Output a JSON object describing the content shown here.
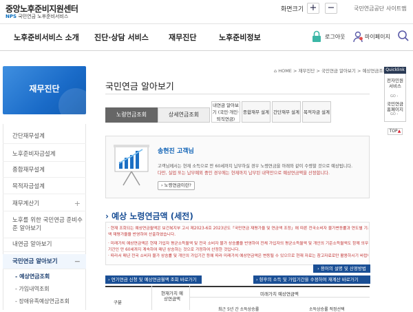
{
  "header": {
    "logo_title": "중앙노후준비지원센터",
    "logo_nps": "NPS",
    "logo_sub": "국민연금 노후준비서비스",
    "font_size_label": "화면크기",
    "font_plus": "+",
    "font_minus": "−",
    "nps_link": "국민연금공단",
    "sitemap_link": "사이트맵"
  },
  "nav": {
    "items": [
      "노후준비서비스 소개",
      "진단·상담 서비스",
      "재무진단",
      "노후준비정보"
    ],
    "logout": "로그아웃",
    "mypage": "마이페이지"
  },
  "sidebar": {
    "banner_title": "재무진단",
    "items": [
      "간단재무설계",
      "노후준비자금설계",
      "종합재무설계",
      "목적자금설계",
      "재무계산기",
      "노후를 위한 국민연금 준비수준 알아보기",
      "내연금 알아보기",
      "국민연금 알아보기"
    ],
    "sub_items": [
      "- 예상연금조회",
      "- 가입내역조회",
      "- 장애유족예상연금조회"
    ]
  },
  "main": {
    "breadcrumb": "⌂ HOME > 재무진단 > 국민연금 알아보기 > 예상연금조회",
    "title": "국민연금 알아보기",
    "tabs": [
      "노령연금조회",
      "상세연금조회",
      "내연금 알아보기 (국민·개인·퇴직연금)",
      "종합재무 설계",
      "간단재무 설계",
      "목적자금 설계"
    ],
    "user_name": "송현진 고객님",
    "info_line_1": "고객님께서는 현재 소득으로 만 60세까지 납부하실 경우 노령연금을 아래와 같이 수령할 것으로 예상됩니다.",
    "info_line_2": "다만, 실업 또는 납부예외 중인 경우에는 현재까지 납부된 내역만으로 예상연금액을 산정합니다.",
    "info_button": "› 노령연금이란?",
    "section_heading": "예상 노령연금액 (세전)",
    "notes": [
      "· 현재 조회되는 예상연금월액은 보건복지부 고시 제2023-6호 2023년도「국민연금 재평가율 및 연금액 조정」에 따른 전국소비자 물가변동률과 연도별 기준소득월",
      "액 재평가율을 반영하여 산출하였습니다.",
      "· 미래가치 예상연금액은 현재 가입자 평균소득월액 및 전국 소비자 물가 상승률을 반영하여 전체 가입자의 평균소득월액 및 개인의 기준소득월액도 함께 의무가입",
      "기간인 만 60세까지 계속하여 매년 상승하는 것으로 가정하여 산정한 것입니다.",
      "· 따라서 매년 전국 소비자 물가 상승률 및 개인의 가입기간 등에 따라 미래가치 예상연금액은 변동될 수 있으므로 현재 자료는 참고자료로만 활용하시기 바랍니다."
    ],
    "guide_button": "› 용어의 설명 및 산정방법",
    "btn_left": "› 연기연금 신청 및 예상연금월액 조회 바로가기",
    "btn_right": "› 향후의 소득 및 가입기간을 수정하여 재계산 바로가기",
    "table": {
      "col_gubun": "구분",
      "col_current": "현재가치 예상연금액",
      "col_future": "미래가치 예상연금액",
      "sub1": "최근 5년 간 소득상승률",
      "sub2": "소득상승률 적정선택"
    }
  },
  "quicklink": {
    "head": "Quicklink",
    "item1": "전자민원 서비스",
    "item1_go": "GO ›",
    "item2": "국민연금 홈페이지",
    "item2_go": "GO ›",
    "top": "TOP"
  }
}
